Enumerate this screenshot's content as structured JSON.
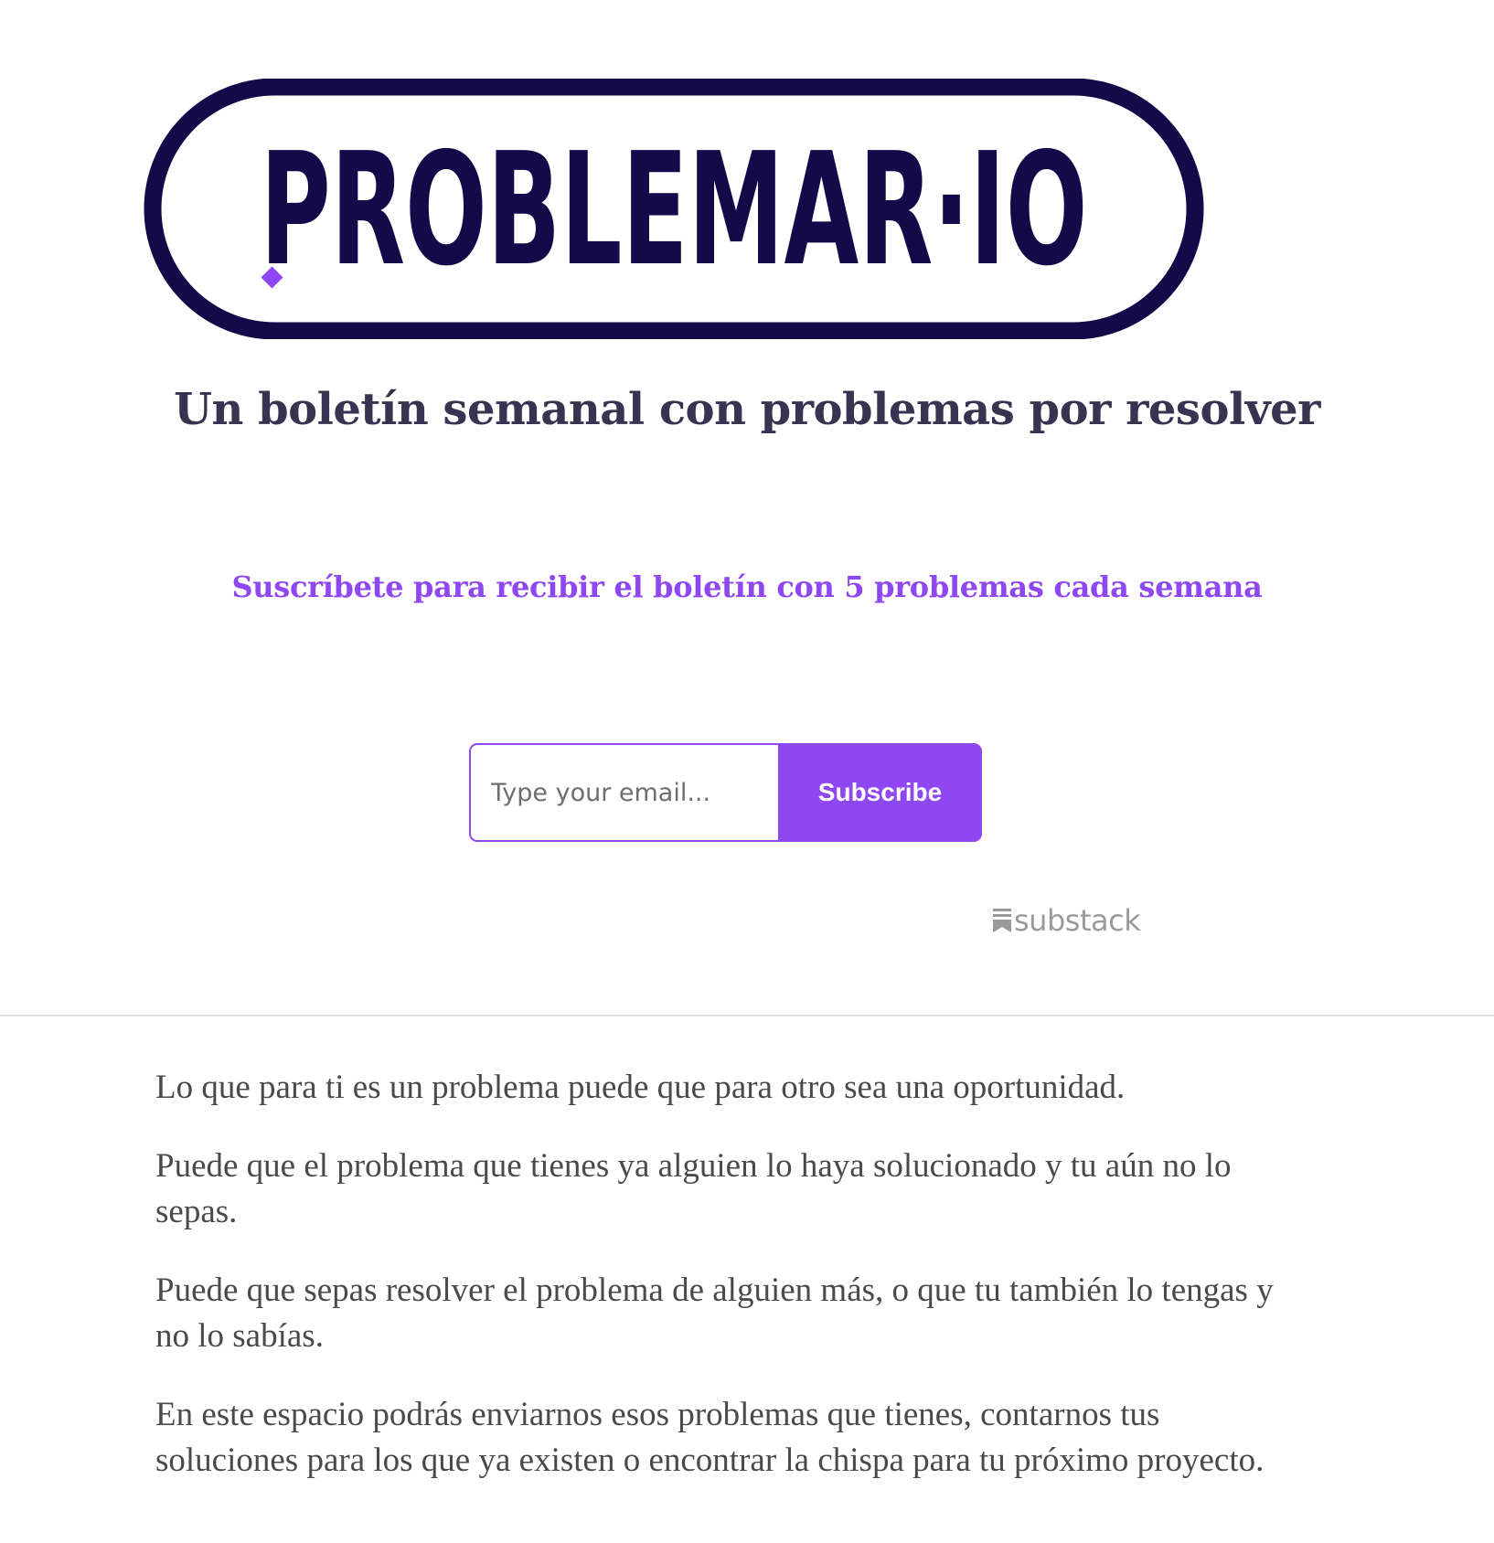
{
  "logo": {
    "text": "PROBLEMAR·IO",
    "colors": {
      "outline": "#140a4a",
      "accent": "#8f47f1"
    }
  },
  "tagline": "Un boletín semanal con problemas por resolver",
  "subscribe_cta": "Suscríbete para recibir el boletín con 5 problemas cada semana",
  "form": {
    "email_placeholder": "Type your email...",
    "email_value": "",
    "subscribe_label": "Subscribe"
  },
  "powered_by": {
    "icon": "substack-icon",
    "label": "substack"
  },
  "paragraphs": [
    "Lo que para ti es un problema puede que para otro sea una oportunidad.",
    "Puede que el problema que tienes ya alguien lo haya solucionado y tu aún no lo sepas.",
    "Puede que sepas resolver el problema de alguien más, o que tu también lo tengas y no lo sabías.",
    "En este espacio podrás enviarnos esos problemas que tienes, contarnos tus soluciones para los que ya existen o encontrar la chispa para tu próximo proyecto."
  ],
  "colors": {
    "brand_purple": "#8f47f1",
    "navy": "#140a4a",
    "tagline": "#363450",
    "body_text": "#4a4a4a",
    "muted": "#9a9a9a"
  }
}
